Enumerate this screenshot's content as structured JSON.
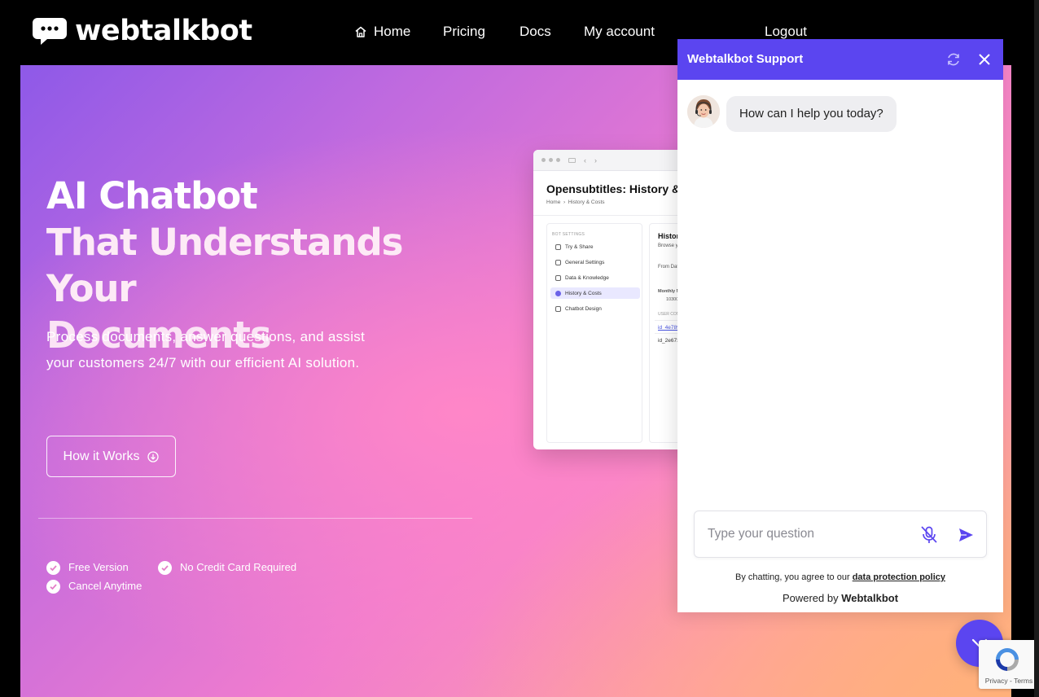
{
  "nav": {
    "logo_text": "webtalkbot",
    "home": "Home",
    "pricing": "Pricing",
    "docs": "Docs",
    "my_account": "My account",
    "logout": "Logout"
  },
  "hero": {
    "headline_line1": "AI Chatbot",
    "headline_line2": "That Understands Your",
    "headline_line3": "Documents",
    "subtitle": "Process documents, answer questions, and assist your customers 24/7 with our efficient AI solution.",
    "cta": "How it Works",
    "features": [
      "Free Version",
      "No Credit Card Required",
      "Cancel Anytime"
    ]
  },
  "preview": {
    "title": "Opensubtitles: History &",
    "crumb_home": "Home",
    "crumb_current": "History & Costs",
    "side_header": "BOT SETTINGS",
    "side_items": [
      "Try & Share",
      "General Settings",
      "Data & Knowledge",
      "History & Costs",
      "Chatbot Design"
    ],
    "main_heading": "History",
    "main_sub": "Browse yo",
    "from_date": "From Date",
    "monthly": "Monthly Me",
    "monthly_val": "10300",
    "user_conv": "USER CONV",
    "id1": "id_4e789",
    "id2": "id_2e673"
  },
  "chat": {
    "title": "Webtalkbot Support",
    "greeting": "How can I help you today?",
    "input_placeholder": "Type your question",
    "terms_prefix": "By chatting, you agree to our",
    "terms_link": "data protection policy",
    "powered_prefix": "Powered by",
    "powered_brand": "Webtalkbot"
  },
  "recaptcha": {
    "links": "Privacy - Terms"
  },
  "colors": {
    "accent": "#5b45f0",
    "nav_bg": "#000000"
  }
}
